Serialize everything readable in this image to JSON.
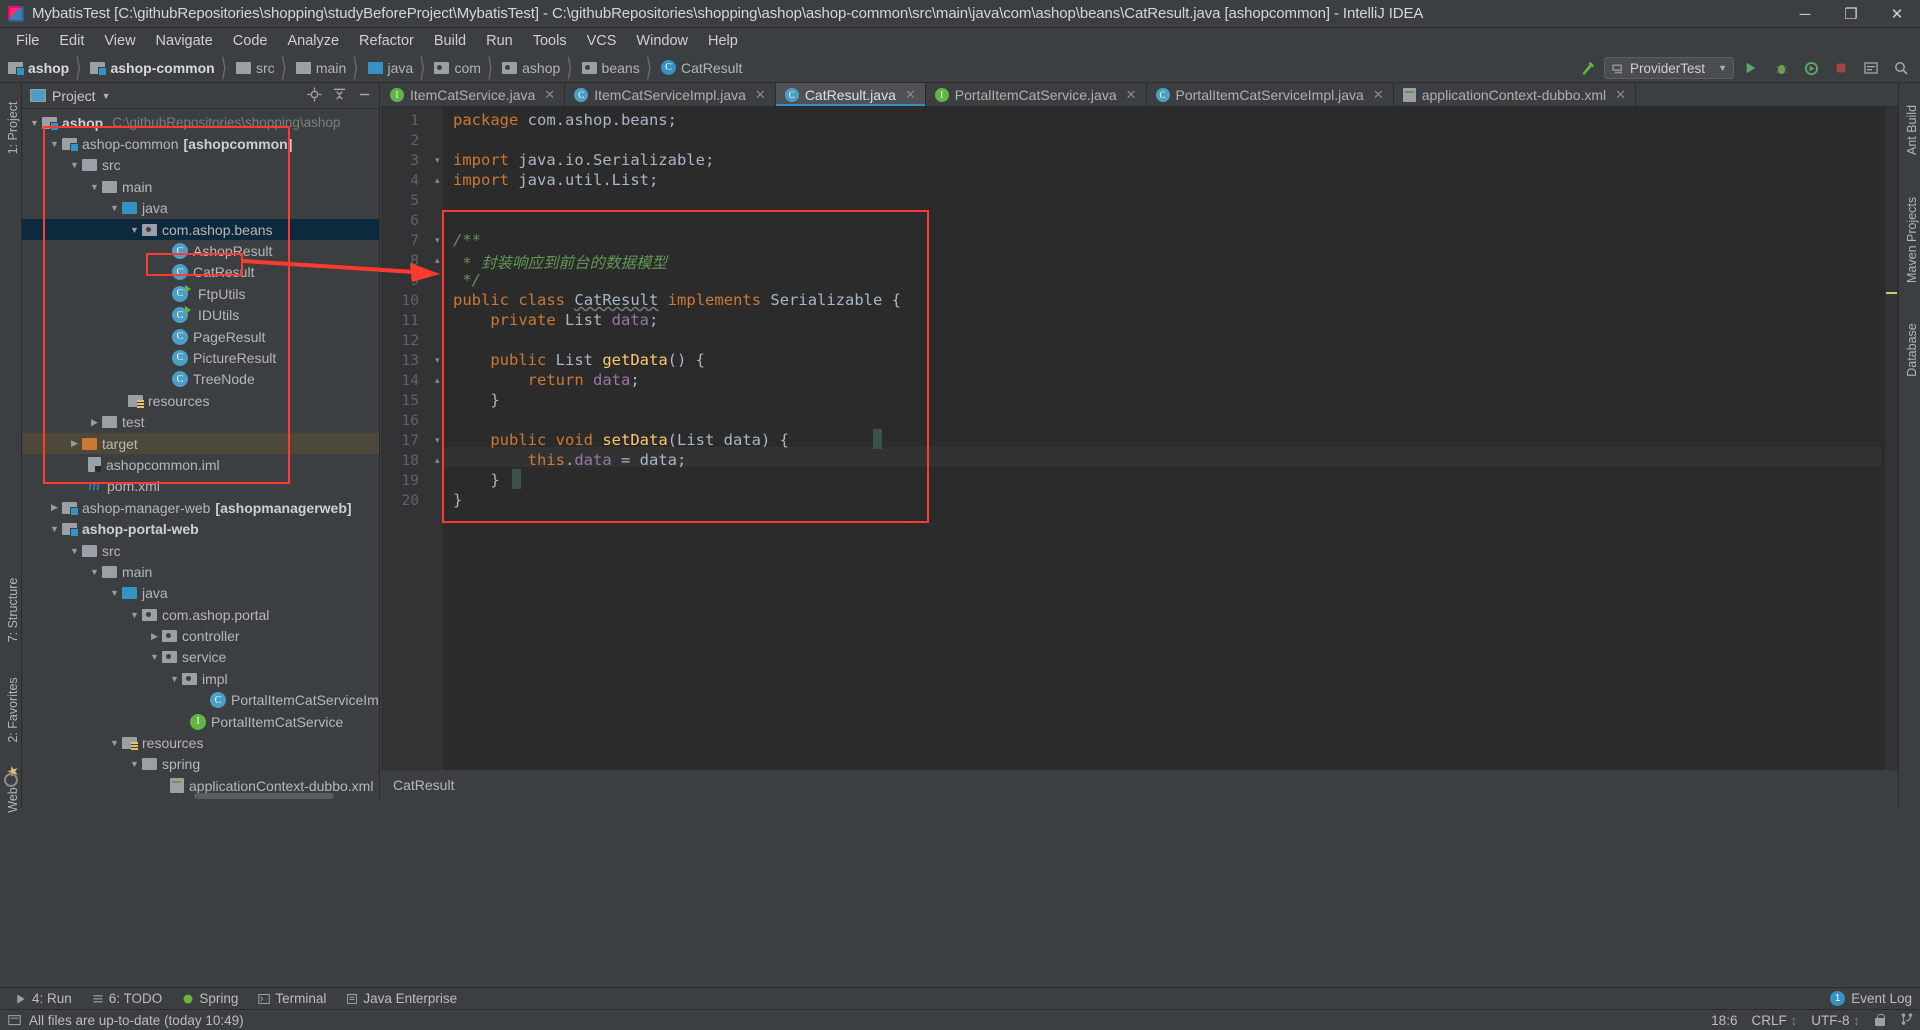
{
  "window": {
    "title": "MybatisTest [C:\\githubRepositories\\shopping\\studyBeforeProject\\MybatisTest] - C:\\githubRepositories\\shopping\\ashop\\ashop-common\\src\\main\\java\\com\\ashop\\beans\\CatResult.java [ashopcommon] - IntelliJ IDEA",
    "minimize": "─",
    "maximize": "❐",
    "close": "✕"
  },
  "menu": [
    "File",
    "Edit",
    "View",
    "Navigate",
    "Code",
    "Analyze",
    "Refactor",
    "Build",
    "Run",
    "Tools",
    "VCS",
    "Window",
    "Help"
  ],
  "breadcrumbs": [
    {
      "label": "ashop",
      "icon": "module-icon",
      "bold": true
    },
    {
      "label": "ashop-common",
      "icon": "module-icon",
      "bold": true
    },
    {
      "label": "src",
      "icon": "folder-icon",
      "bold": false
    },
    {
      "label": "main",
      "icon": "folder-icon",
      "bold": false
    },
    {
      "label": "java",
      "icon": "source-folder-icon",
      "bold": false
    },
    {
      "label": "com",
      "icon": "package-icon",
      "bold": false
    },
    {
      "label": "ashop",
      "icon": "package-icon",
      "bold": false
    },
    {
      "label": "beans",
      "icon": "package-icon",
      "bold": false
    },
    {
      "label": "CatResult",
      "icon": "class-icon",
      "bold": false
    }
  ],
  "toolbar": {
    "run_config": "ProviderTest",
    "icons": [
      "build-icon",
      "run-icon",
      "debug-icon",
      "coverage-icon",
      "stop-icon",
      "settings-icon",
      "search-icon"
    ]
  },
  "project_panel": {
    "title": "Project",
    "tree": [
      {
        "depth": 0,
        "arrow": "down",
        "icon": "module-icon",
        "label": "ashop",
        "bold": true,
        "path": "C:\\githubRepositories\\shopping\\ashop",
        "state": "none"
      },
      {
        "depth": 1,
        "arrow": "down",
        "icon": "module-icon",
        "label": "ashop-common",
        "bold": false,
        "suffix": "[ashopcommon]",
        "state": "none"
      },
      {
        "depth": 2,
        "arrow": "down",
        "icon": "folder-icon",
        "label": "src",
        "bold": false,
        "state": "none"
      },
      {
        "depth": 3,
        "arrow": "down",
        "icon": "folder-icon",
        "label": "main",
        "bold": false,
        "state": "none"
      },
      {
        "depth": 4,
        "arrow": "down",
        "icon": "source-folder-icon",
        "label": "java",
        "bold": false,
        "state": "none"
      },
      {
        "depth": 5,
        "arrow": "down",
        "icon": "package-icon",
        "label": "com.ashop.beans",
        "bold": false,
        "state": "selected"
      },
      {
        "depth": 6,
        "arrow": "none",
        "icon": "class-icon",
        "label": "AshopResult",
        "bold": false,
        "state": "none"
      },
      {
        "depth": 6,
        "arrow": "none",
        "icon": "class-icon",
        "label": "CatResult",
        "bold": false,
        "state": "none"
      },
      {
        "depth": 6,
        "arrow": "none",
        "icon": "runnable-class-icon",
        "label": "FtpUtils",
        "bold": false,
        "state": "none"
      },
      {
        "depth": 6,
        "arrow": "none",
        "icon": "runnable-class-icon",
        "label": "IDUtils",
        "bold": false,
        "state": "none"
      },
      {
        "depth": 6,
        "arrow": "none",
        "icon": "class-icon",
        "label": "PageResult",
        "bold": false,
        "state": "none"
      },
      {
        "depth": 6,
        "arrow": "none",
        "icon": "class-icon",
        "label": "PictureResult",
        "bold": false,
        "state": "none"
      },
      {
        "depth": 6,
        "arrow": "none",
        "icon": "class-icon",
        "label": "TreeNode",
        "bold": false,
        "state": "none"
      },
      {
        "depth": 4,
        "arrow": "none",
        "icon": "resource-folder-icon",
        "label": "resources",
        "bold": false,
        "state": "none"
      },
      {
        "depth": 3,
        "arrow": "right",
        "icon": "folder-icon",
        "label": "test",
        "bold": false,
        "state": "none"
      },
      {
        "depth": 2,
        "arrow": "right",
        "icon": "excluded-folder-icon",
        "label": "target",
        "bold": false,
        "state": "highlight"
      },
      {
        "depth": 3,
        "arrow": "none",
        "icon": "iml-file-icon",
        "label": "ashopcommon.iml",
        "bold": false,
        "state": "none"
      },
      {
        "depth": 3,
        "arrow": "none",
        "icon": "maven-icon",
        "label": "pom.xml",
        "bold": false,
        "state": "none"
      },
      {
        "depth": 1,
        "arrow": "right",
        "icon": "module-icon",
        "label": "ashop-manager-web",
        "bold": false,
        "suffix": "[ashopmanagerweb]",
        "state": "none"
      },
      {
        "depth": 1,
        "arrow": "down",
        "icon": "module-icon",
        "label": "ashop-portal-web",
        "bold": true,
        "state": "none"
      },
      {
        "depth": 2,
        "arrow": "down",
        "icon": "folder-icon",
        "label": "src",
        "bold": false,
        "state": "none"
      },
      {
        "depth": 3,
        "arrow": "down",
        "icon": "folder-icon",
        "label": "main",
        "bold": false,
        "state": "none"
      },
      {
        "depth": 4,
        "arrow": "down",
        "icon": "source-folder-icon",
        "label": "java",
        "bold": false,
        "state": "none"
      },
      {
        "depth": 5,
        "arrow": "down",
        "icon": "package-icon",
        "label": "com.ashop.portal",
        "bold": false,
        "state": "none"
      },
      {
        "depth": 6,
        "arrow": "right",
        "icon": "package-icon",
        "label": "controller",
        "bold": false,
        "state": "none"
      },
      {
        "depth": 6,
        "arrow": "down",
        "icon": "package-icon",
        "label": "service",
        "bold": false,
        "state": "none"
      },
      {
        "depth": 7,
        "arrow": "down",
        "icon": "package-icon",
        "label": "impl",
        "bold": false,
        "state": "none"
      },
      {
        "depth": 8,
        "arrow": "none",
        "icon": "class-icon",
        "label": "PortalItemCatServiceImpl",
        "bold": false,
        "state": "none"
      },
      {
        "depth": 7,
        "arrow": "none",
        "icon": "interface-icon",
        "label": "PortalItemCatService",
        "bold": false,
        "state": "none"
      },
      {
        "depth": 4,
        "arrow": "down",
        "icon": "resource-folder-icon",
        "label": "resources",
        "bold": false,
        "state": "none"
      },
      {
        "depth": 5,
        "arrow": "down",
        "icon": "folder-icon",
        "label": "spring",
        "bold": false,
        "state": "none"
      },
      {
        "depth": 6,
        "arrow": "none",
        "icon": "xml-file-icon",
        "label": "applicationContext-dubbo.xml",
        "bold": false,
        "state": "none"
      }
    ]
  },
  "editor": {
    "tabs": [
      {
        "label": "ItemCatService.java",
        "icon": "interface-icon",
        "active": false,
        "closable": true
      },
      {
        "label": "ItemCatServiceImpl.java",
        "icon": "class-icon",
        "active": false,
        "closable": true
      },
      {
        "label": "CatResult.java",
        "icon": "class-icon",
        "active": true,
        "closable": true
      },
      {
        "label": "PortalItemCatService.java",
        "icon": "interface-icon",
        "active": false,
        "closable": true
      },
      {
        "label": "PortalItemCatServiceImpl.java",
        "icon": "class-icon",
        "active": false,
        "closable": true
      },
      {
        "label": "applicationContext-dubbo.xml",
        "icon": "xml-file-icon",
        "active": false,
        "closable": true
      }
    ],
    "line_numbers": [
      "1",
      "2",
      "3",
      "4",
      "5",
      "6",
      "7",
      "8",
      "9",
      "10",
      "11",
      "12",
      "13",
      "14",
      "15",
      "16",
      "17",
      "18",
      "19",
      "20"
    ],
    "code_lines": [
      {
        "n": 1,
        "segments": [
          {
            "t": "package",
            "c": "k"
          },
          {
            "t": " com.ashop.beans;",
            "c": "pln"
          }
        ]
      },
      {
        "n": 2,
        "segments": []
      },
      {
        "n": 3,
        "segments": [
          {
            "t": "import",
            "c": "k"
          },
          {
            "t": " java.io.Serializable;",
            "c": "pln"
          }
        ]
      },
      {
        "n": 4,
        "segments": [
          {
            "t": "import",
            "c": "k"
          },
          {
            "t": " java.util.List;",
            "c": "pln"
          }
        ]
      },
      {
        "n": 5,
        "segments": []
      },
      {
        "n": 6,
        "segments": [
          {
            "t": "/**",
            "c": "cm"
          }
        ]
      },
      {
        "n": 7,
        "segments": [
          {
            "t": " * 封装响应到前台的数据模型",
            "c": "cm"
          }
        ]
      },
      {
        "n": 8,
        "segments": [
          {
            "t": " */",
            "c": "cm"
          }
        ]
      },
      {
        "n": 9,
        "segments": [
          {
            "t": "public",
            "c": "k"
          },
          {
            "t": " ",
            "c": "pln"
          },
          {
            "t": "class",
            "c": "k"
          },
          {
            "t": " ",
            "c": "pln"
          },
          {
            "t": "CatResult",
            "c": "undl"
          },
          {
            "t": " ",
            "c": "pln"
          },
          {
            "t": "implements",
            "c": "k"
          },
          {
            "t": " Serializable {",
            "c": "pln"
          }
        ]
      },
      {
        "n": 10,
        "segments": [
          {
            "t": "    ",
            "c": "pln"
          },
          {
            "t": "private",
            "c": "k"
          },
          {
            "t": " List ",
            "c": "pln"
          },
          {
            "t": "data",
            "c": "fld"
          },
          {
            "t": ";",
            "c": "pln"
          }
        ]
      },
      {
        "n": 11,
        "segments": []
      },
      {
        "n": 12,
        "segments": [
          {
            "t": "    ",
            "c": "pln"
          },
          {
            "t": "public",
            "c": "k"
          },
          {
            "t": " List ",
            "c": "pln"
          },
          {
            "t": "getData",
            "c": "fn"
          },
          {
            "t": "() {",
            "c": "pln"
          }
        ]
      },
      {
        "n": 13,
        "segments": [
          {
            "t": "        ",
            "c": "pln"
          },
          {
            "t": "return",
            "c": "k"
          },
          {
            "t": " ",
            "c": "pln"
          },
          {
            "t": "data",
            "c": "fld"
          },
          {
            "t": ";",
            "c": "pln"
          }
        ]
      },
      {
        "n": 14,
        "segments": [
          {
            "t": "    }",
            "c": "pln"
          }
        ]
      },
      {
        "n": 15,
        "segments": []
      },
      {
        "n": 16,
        "segments": [
          {
            "t": "    ",
            "c": "pln"
          },
          {
            "t": "public",
            "c": "k"
          },
          {
            "t": " ",
            "c": "pln"
          },
          {
            "t": "void",
            "c": "k"
          },
          {
            "t": " ",
            "c": "pln"
          },
          {
            "t": "setData",
            "c": "fn"
          },
          {
            "t": "(List data) {",
            "c": "pln"
          }
        ]
      },
      {
        "n": 17,
        "segments": [
          {
            "t": "        ",
            "c": "pln"
          },
          {
            "t": "this",
            "c": "k"
          },
          {
            "t": ".",
            "c": "pln"
          },
          {
            "t": "data",
            "c": "fld"
          },
          {
            "t": " = data;",
            "c": "pln"
          }
        ]
      },
      {
        "n": 18,
        "segments": [
          {
            "t": "    }",
            "c": "pln"
          }
        ]
      },
      {
        "n": 19,
        "segments": [
          {
            "t": "}",
            "c": "pln"
          }
        ]
      },
      {
        "n": 20,
        "segments": []
      }
    ],
    "breadcrumb_footer": "CatResult"
  },
  "left_strip": [
    {
      "label": "1: Project",
      "active": true
    },
    {
      "label": "7: Structure",
      "active": false
    },
    {
      "label": "2: Favorites",
      "active": false
    },
    {
      "label": "Web",
      "active": false
    }
  ],
  "right_strip": [
    {
      "label": "Ant Build"
    },
    {
      "label": "Maven Projects"
    },
    {
      "label": "Database"
    }
  ],
  "bottom_bar": {
    "items": [
      {
        "label": "4: Run",
        "icon": "run-icon"
      },
      {
        "label": "6: TODO",
        "icon": "todo-icon"
      },
      {
        "label": "Spring",
        "icon": "spring-icon"
      },
      {
        "label": "Terminal",
        "icon": "terminal-icon"
      },
      {
        "label": "Java Enterprise",
        "icon": "java-ee-icon"
      }
    ],
    "event_log": "Event Log",
    "event_log_count": "1"
  },
  "status_bar": {
    "message": "All files are up-to-date (today 10:49)",
    "caret": "18:6",
    "line_separator": "CRLF",
    "encoding": "UTF-8",
    "lock_icon": "lock-icon",
    "branch_icon": "git-branch-icon"
  }
}
